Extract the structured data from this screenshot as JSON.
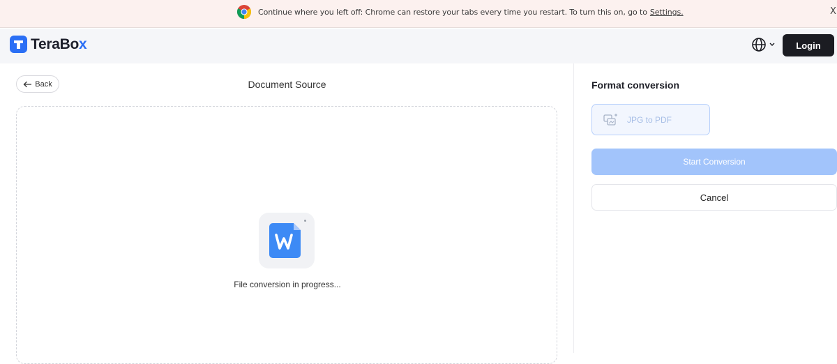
{
  "banner": {
    "message": "Continue where you left off: Chrome can restore your tabs every time you restart. To turn this on, go to",
    "link": "Settings.",
    "close": "X"
  },
  "header": {
    "logo_text": "TeraBo",
    "logo_accent": "x",
    "login_label": "Login",
    "brand_color": "#2b6ff5"
  },
  "source": {
    "back_label": "Back",
    "title": "Document Source",
    "status": "File conversion in progress..."
  },
  "conversion": {
    "title": "Format conversion",
    "option_label": "JPG to PDF",
    "start_label": "Start Conversion",
    "cancel_label": "Cancel"
  }
}
